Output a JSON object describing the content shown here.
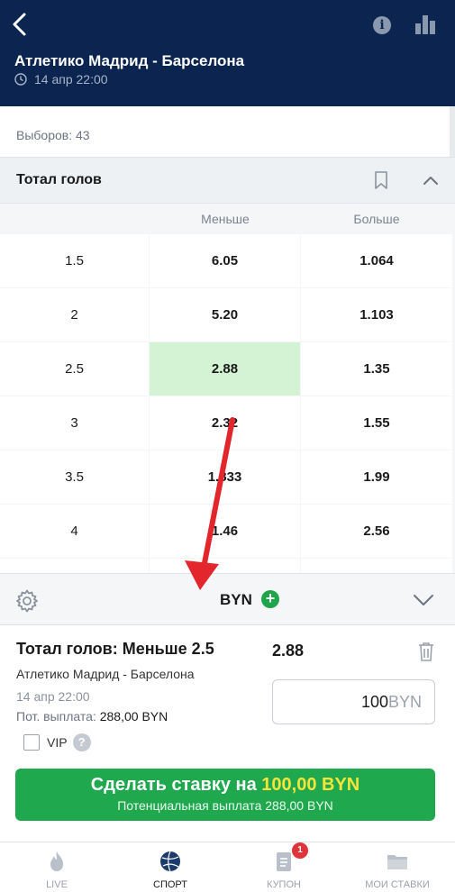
{
  "header": {
    "match_title": "Атлетико Мадрид - Барселона",
    "match_time": "14 апр 22:00",
    "icons": [
      "back-icon",
      "info-icon",
      "stats-icon",
      "clock-icon"
    ],
    "info_glyph": "i",
    "background_color": "#0b2550"
  },
  "choices": {
    "text": "Выборов: 43"
  },
  "market": {
    "title": "Тотал голов",
    "columns": {
      "under": "Меньше",
      "over": "Больше"
    },
    "rows": [
      {
        "total": "1.5",
        "under": "6.05",
        "over": "1.064",
        "selected": false
      },
      {
        "total": "2",
        "under": "5.20",
        "over": "1.103",
        "selected": false
      },
      {
        "total": "2.5",
        "under": "2.88",
        "over": "1.35",
        "selected": true
      },
      {
        "total": "3",
        "under": "2.32",
        "over": "1.55",
        "selected": false
      },
      {
        "total": "3.5",
        "under": "1.833",
        "over": "1.99",
        "selected": false
      },
      {
        "total": "4",
        "under": "1.46",
        "over": "2.56",
        "selected": false
      },
      {
        "total": "",
        "under": "",
        "over": "",
        "selected": false
      }
    ],
    "selected_color": "#d4f3d4"
  },
  "coupon": {
    "currency": "BYN",
    "plus_glyph": "+",
    "bet_title": "Тотал голов: Меньше 2.5",
    "bet_odds": "2.88",
    "bet_match": "Атлетико Мадрид - Барселона",
    "bet_date": "14 апр 22:00",
    "payout_label": "Пот. выплата:",
    "payout_value": "288,00 BYN",
    "stake_value": "100",
    "stake_currency": "BYN",
    "vip_label": "VIP",
    "help_glyph": "?",
    "place_bet_prefix": "Сделать ставку на ",
    "place_bet_amount": "100,00 BYN",
    "place_bet_sub": "Потенциальная выплата 288,00 BYN",
    "button_color": "#20a84f",
    "amount_color": "#f5e53a"
  },
  "nav": {
    "items": [
      {
        "label": "LIVE",
        "icon": "fire-icon",
        "active": false
      },
      {
        "label": "СПОРТ",
        "icon": "ball-icon",
        "active": true
      },
      {
        "label": "КУПОН",
        "icon": "coupon-icon",
        "active": false,
        "badge": "1"
      },
      {
        "label": "МОИ СТАВКИ",
        "icon": "folder-icon",
        "active": false
      }
    ]
  },
  "annotation": {
    "arrow_color": "#e3262c"
  }
}
